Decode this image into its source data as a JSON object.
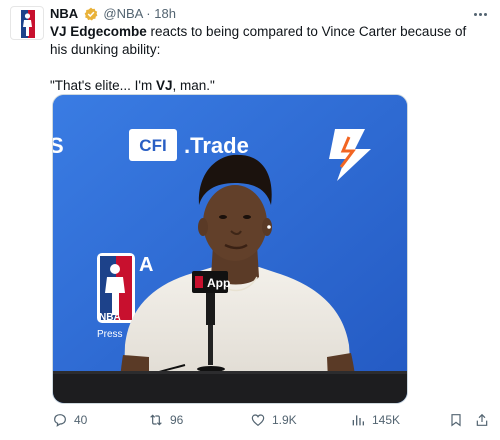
{
  "author": {
    "display_name": "NBA",
    "handle": "@NBA",
    "separator": "·",
    "age": "18h"
  },
  "tweet": {
    "player": "VJ Edgecombe",
    "text_rest": " reacts to being compared to Vince Carter because of his dunking ability:",
    "quote_start": "\"That's elite... I'm ",
    "quote_bold": "VJ",
    "quote_end": ", man.\""
  },
  "media": {
    "backdrop_brand": "CFI",
    "backdrop_text": ".Trade",
    "mic_label": "App",
    "side_text_1": "NBA",
    "side_text_2": "Press",
    "side_letter": "A"
  },
  "actions": {
    "replies": "40",
    "reposts": "96",
    "likes": "1.9K",
    "views": "145K"
  },
  "colors": {
    "backdrop_blue": "#2f6fd8",
    "text_secondary": "#536471",
    "verified_gold": "#e9b23a"
  },
  "icons": [
    "nba-logo-icon",
    "verified-badge-icon",
    "more-options-icon",
    "reply-icon",
    "repost-icon",
    "like-icon",
    "views-icon",
    "bookmark-icon",
    "share-icon"
  ]
}
